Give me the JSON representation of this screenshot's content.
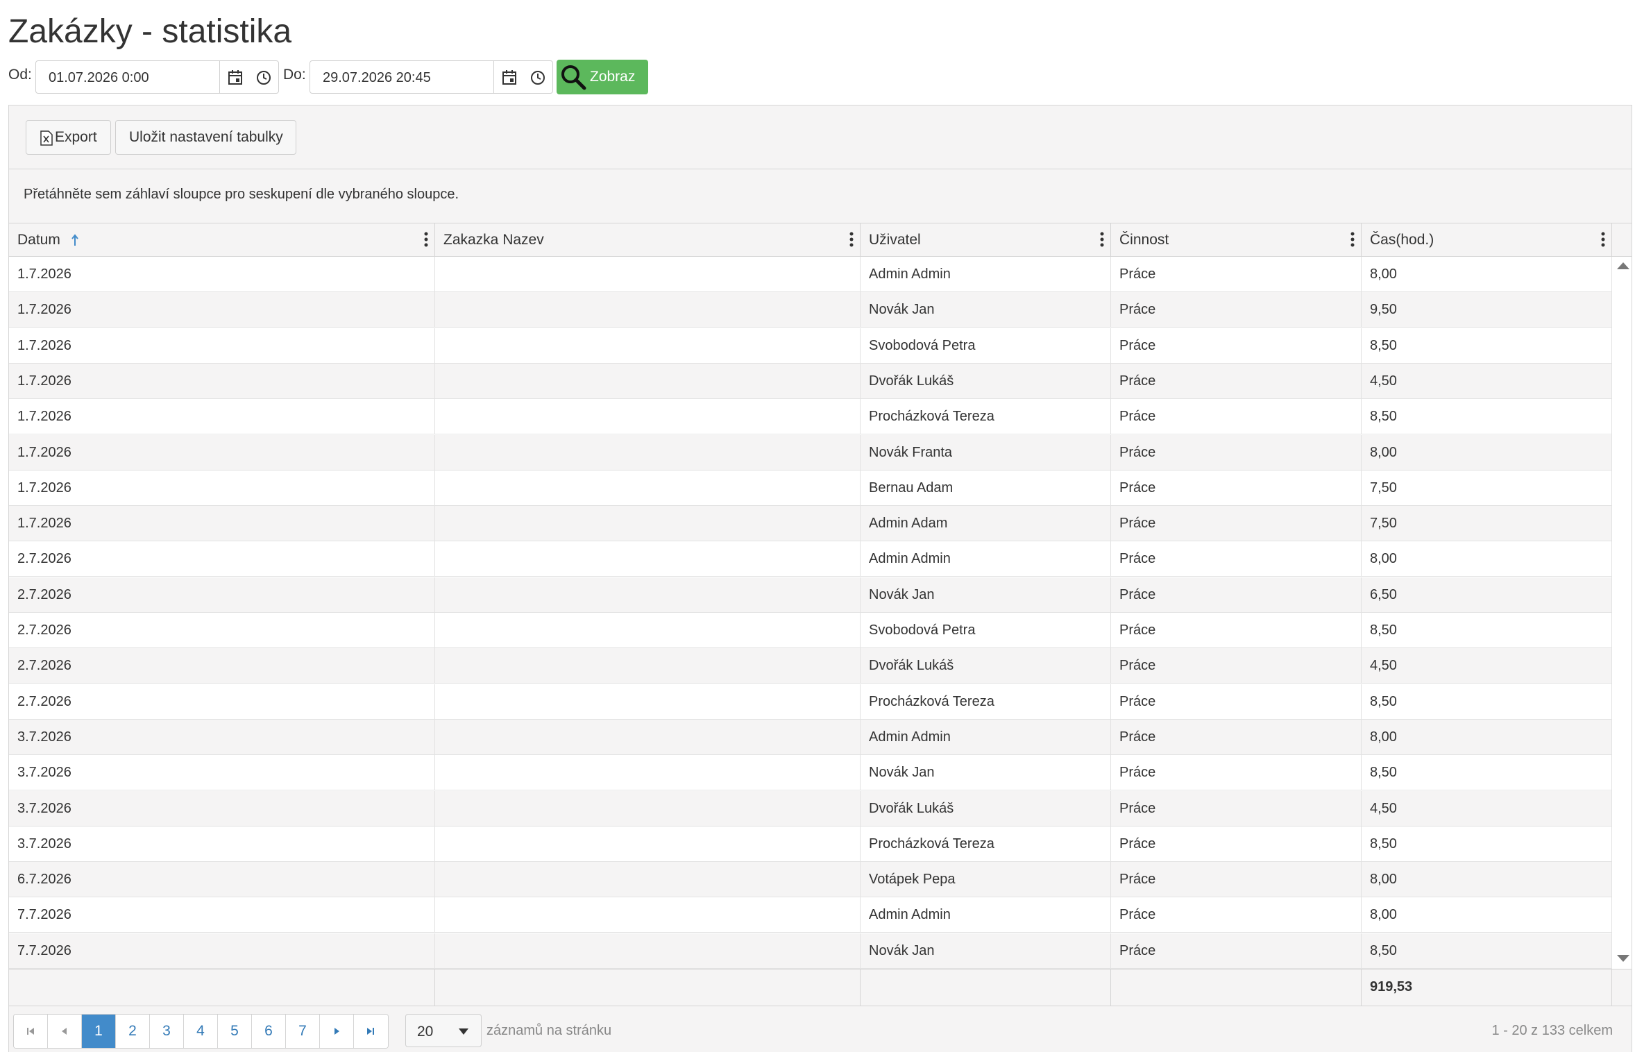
{
  "page": {
    "title": "Zakázky - statistika"
  },
  "filter": {
    "from_label": "Od:",
    "from_value": "01.07.2026 0:00",
    "to_label": "Do:",
    "to_value": "29.07.2026 20:45",
    "show_label": "Zobraz",
    "show_color": "#5cb85c"
  },
  "toolbar": {
    "export_label": "Export",
    "save_label": "Uložit nastavení tabulky"
  },
  "group_hint": "Přetáhněte sem záhlaví sloupce pro seskupení dle vybraného sloupce.",
  "columns": [
    "Datum",
    "Zakazka Nazev",
    "Uživatel",
    "Činnost",
    "Čas(hod.)"
  ],
  "sort": {
    "column": "Datum",
    "direction": "ascending"
  },
  "rows": [
    [
      "1.7.2026",
      "",
      "Admin Admin",
      "Práce",
      "8,00"
    ],
    [
      "1.7.2026",
      "",
      "Novák Jan",
      "Práce",
      "9,50"
    ],
    [
      "1.7.2026",
      "",
      "Svobodová Petra",
      "Práce",
      "8,50"
    ],
    [
      "1.7.2026",
      "",
      "Dvořák Lukáš",
      "Práce",
      "4,50"
    ],
    [
      "1.7.2026",
      "",
      "Procházková Tereza",
      "Práce",
      "8,50"
    ],
    [
      "1.7.2026",
      "",
      "Novák Franta",
      "Práce",
      "8,00"
    ],
    [
      "1.7.2026",
      "",
      "Bernau Adam",
      "Práce",
      "7,50"
    ],
    [
      "1.7.2026",
      "",
      "Admin Adam",
      "Práce",
      "7,50"
    ],
    [
      "2.7.2026",
      "",
      "Admin Admin",
      "Práce",
      "8,00"
    ],
    [
      "2.7.2026",
      "",
      "Novák Jan",
      "Práce",
      "6,50"
    ],
    [
      "2.7.2026",
      "",
      "Svobodová Petra",
      "Práce",
      "8,50"
    ],
    [
      "2.7.2026",
      "",
      "Dvořák Lukáš",
      "Práce",
      "4,50"
    ],
    [
      "2.7.2026",
      "",
      "Procházková Tereza",
      "Práce",
      "8,50"
    ],
    [
      "3.7.2026",
      "",
      "Admin Admin",
      "Práce",
      "8,00"
    ],
    [
      "3.7.2026",
      "",
      "Novák Jan",
      "Práce",
      "8,50"
    ],
    [
      "3.7.2026",
      "",
      "Dvořák Lukáš",
      "Práce",
      "4,50"
    ],
    [
      "3.7.2026",
      "",
      "Procházková Tereza",
      "Práce",
      "8,50"
    ],
    [
      "6.7.2026",
      "",
      "Votápek Pepa",
      "Práce",
      "8,00"
    ],
    [
      "7.7.2026",
      "",
      "Admin Admin",
      "Práce",
      "8,00"
    ],
    [
      "7.7.2026",
      "",
      "Novák Jan",
      "Práce",
      "8,50"
    ]
  ],
  "footer": {
    "total": "919,53"
  },
  "pager": {
    "pages": [
      "1",
      "2",
      "3",
      "4",
      "5",
      "6",
      "7"
    ],
    "current_page": "1",
    "page_size": "20",
    "per_page_label": "záznamů na stránku",
    "info": "1 - 20 z 133 celkem",
    "active_color": "#428bca"
  },
  "icons": {
    "calendar": "calendar-icon",
    "clock": "clock-icon",
    "search": "search-icon",
    "excel": "excel-icon",
    "column_menu": "kebab-menu-icon",
    "sort": "sort-ascending-icon"
  }
}
